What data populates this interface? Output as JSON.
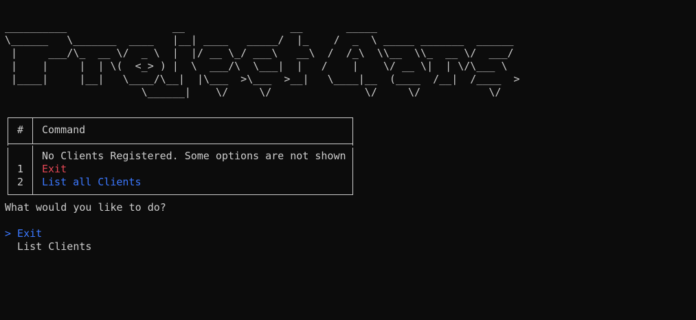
{
  "banner": "__________                 __                 __       _____                    \n\\______   \\_______  ____   |__| ____   _____/  |_    /  _  \\ _____ _______  ______\n |     ___/\\_  __ \\/  _ \\  |  |/ __ \\_/ ___\\   __\\  /  /_\\  \\\\__  \\\\_  __ \\/  ___/\n |    |     |  | \\(  <_> ) |  \\  ___/\\  \\___|  |   /    |    \\/ __ \\|  | \\/\\___ \\ \n |____|     |__|   \\____/\\__|  |\\___  >\\___  >__|   \\____|__  (____  /__|  /____  >\n                      \\______|    \\/     \\/               \\/     \\/           \\/ ",
  "table": {
    "header_num": "#",
    "header_command": "Command",
    "note": "No Clients Registered. Some options are not shown",
    "rows": [
      {
        "num": "1",
        "command": "Exit"
      },
      {
        "num": "2",
        "command": "List all Clients"
      }
    ]
  },
  "prompt": "What would you like to do?",
  "options": [
    {
      "label": "> Exit",
      "selected": true
    },
    {
      "label": "  List Clients",
      "selected": false
    }
  ],
  "colors": {
    "background": "#0c0c0c",
    "text": "#cccccc",
    "exit_red": "#e74856",
    "accent_blue": "#3b78ff"
  }
}
